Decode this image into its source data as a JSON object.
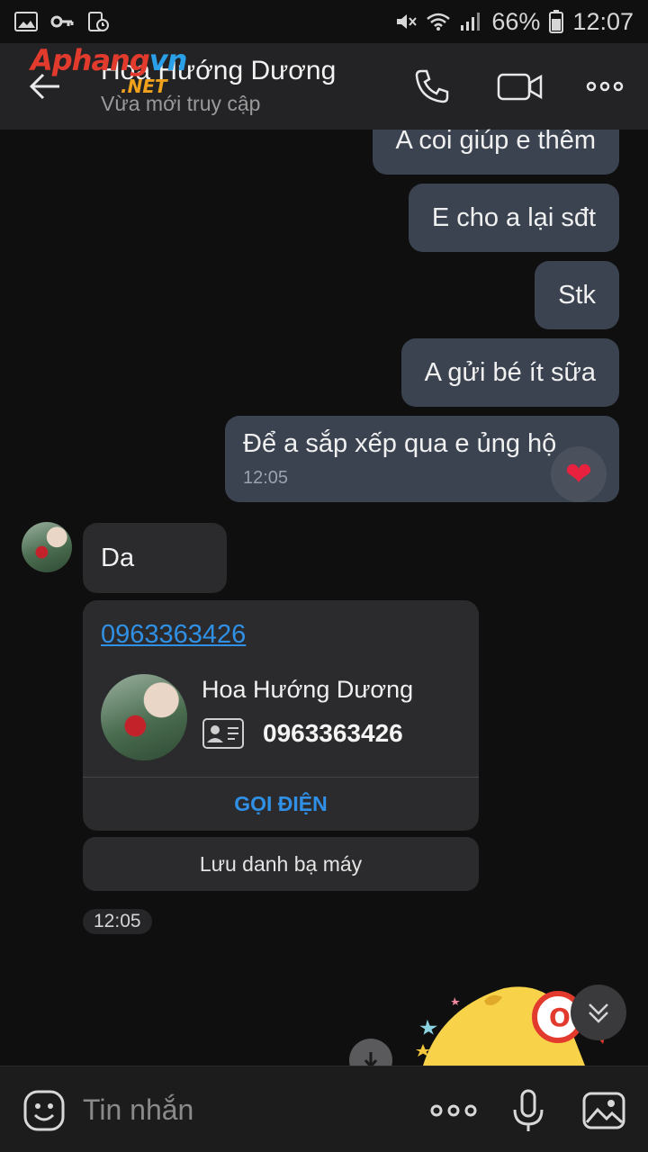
{
  "status_bar": {
    "battery": "66%",
    "time": "12:07",
    "icons": [
      "image-icon",
      "key-icon",
      "screen-lock-icon",
      "mute-icon",
      "wifi-icon",
      "signal-icon",
      "battery-icon"
    ]
  },
  "header": {
    "title": "Hoa Hướng Dương",
    "subtitle": "Vừa mới truy cập",
    "watermark_main": "Aphang",
    "watermark_accent": "vn",
    "watermark_net": ".NET"
  },
  "messages_out": [
    {
      "text": "A coi giúp e thêm"
    },
    {
      "text": "E cho a lại  sđt"
    },
    {
      "text": "Stk"
    },
    {
      "text": "A gửi  bé  ít  sữa"
    },
    {
      "text": "Để  a sắp xếp  qua e ủng hộ",
      "time": "12:05",
      "reaction": "❤"
    }
  ],
  "messages_in": [
    {
      "text": "Da"
    }
  ],
  "contact_card": {
    "phone_link": "0963363426",
    "name": "Hoa Hướng Dương",
    "number": "0963363426",
    "call_label": "GỌI ĐIỆN",
    "save_label": "Lưu danh bạ máy",
    "time": "12:05"
  },
  "input_bar": {
    "placeholder": "Tin nhắn"
  },
  "colors": {
    "background": "#0f0f10",
    "outgoing_bubble": "#3b4350",
    "incoming_bubble": "#2b2b2d",
    "link": "#2f90e6",
    "header": "#232325"
  }
}
